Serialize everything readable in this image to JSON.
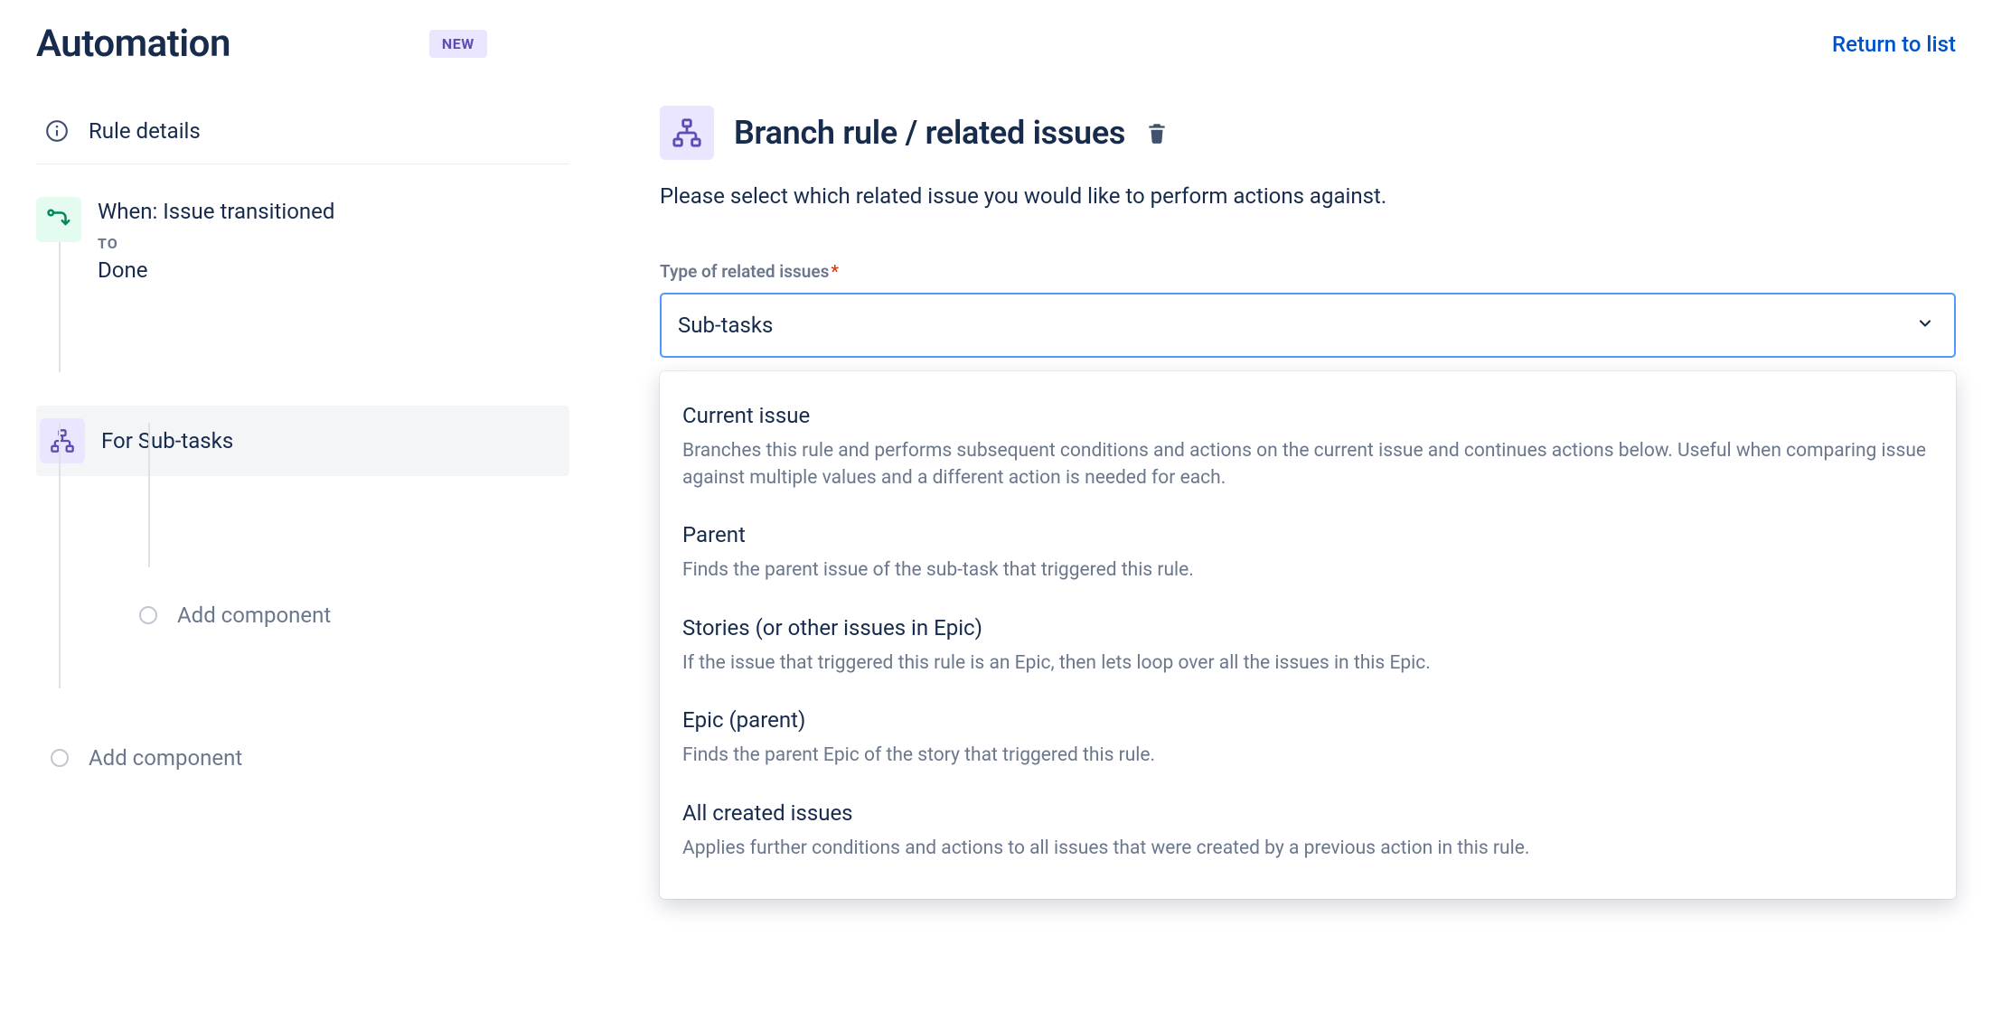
{
  "header": {
    "title": "Automation",
    "badge": "NEW",
    "return_link": "Return to list"
  },
  "sidebar": {
    "rule_details": "Rule details",
    "trigger": {
      "title": "When: Issue transitioned",
      "to_label": "TO",
      "to_value": "Done"
    },
    "branch": {
      "label": "For Sub-tasks"
    },
    "add_component_inner": "Add component",
    "add_component_outer": "Add component"
  },
  "main": {
    "title": "Branch rule / related issues",
    "description": "Please select which related issue you would like to perform actions against.",
    "field_label": "Type of related issues",
    "selected": "Sub-tasks",
    "options": [
      {
        "title": "Current issue",
        "desc": "Branches this rule and performs subsequent conditions and actions on the current issue and continues actions below. Useful when comparing issue against multiple values and a different action is needed for each."
      },
      {
        "title": "Parent",
        "desc": "Finds the parent issue of the sub-task that triggered this rule."
      },
      {
        "title": "Stories (or other issues in Epic)",
        "desc": "If the issue that triggered this rule is an Epic, then lets loop over all the issues in this Epic."
      },
      {
        "title": "Epic (parent)",
        "desc": "Finds the parent Epic of the story that triggered this rule."
      },
      {
        "title": "All created issues",
        "desc": "Applies further conditions and actions to all issues that were created by a previous action in this rule."
      }
    ]
  }
}
